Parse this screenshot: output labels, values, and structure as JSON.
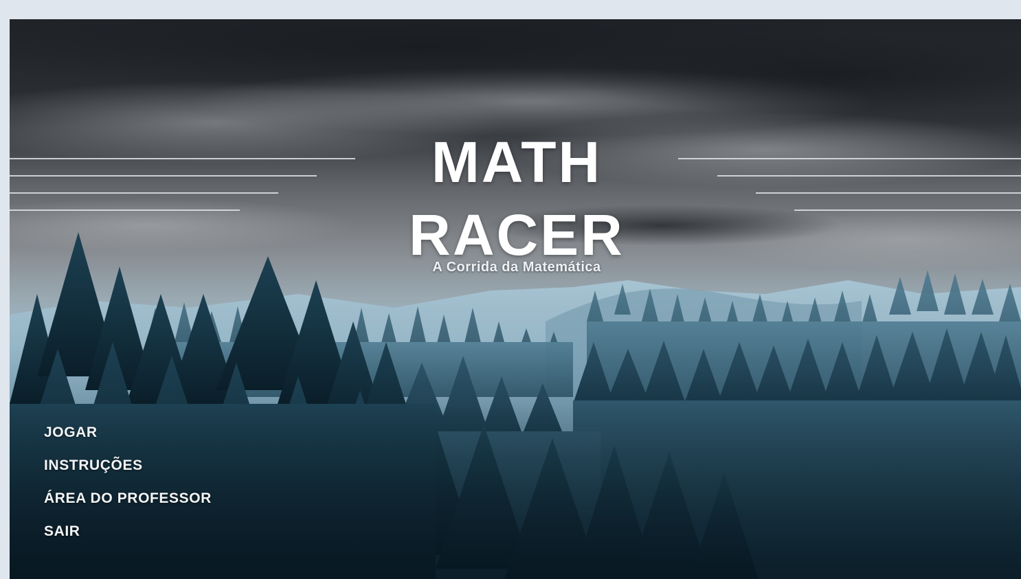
{
  "game": {
    "title_line1": "MATH",
    "title_line2": "RACER",
    "subtitle": "A Corrida da Matemática"
  },
  "menu": {
    "items": [
      {
        "label": "JOGAR"
      },
      {
        "label": "INSTRUÇÕES"
      },
      {
        "label": "ÁREA DO PROFESSOR"
      },
      {
        "label": "SAIR"
      }
    ]
  },
  "colors": {
    "sky_dark": "#23272d",
    "sky_light": "#8e9095",
    "mist": "#9fc0d2",
    "forest_far": "#3f6a80",
    "forest_near": "#0f2a38",
    "text": "#ffffff",
    "page_background": "#dfe6ed"
  }
}
